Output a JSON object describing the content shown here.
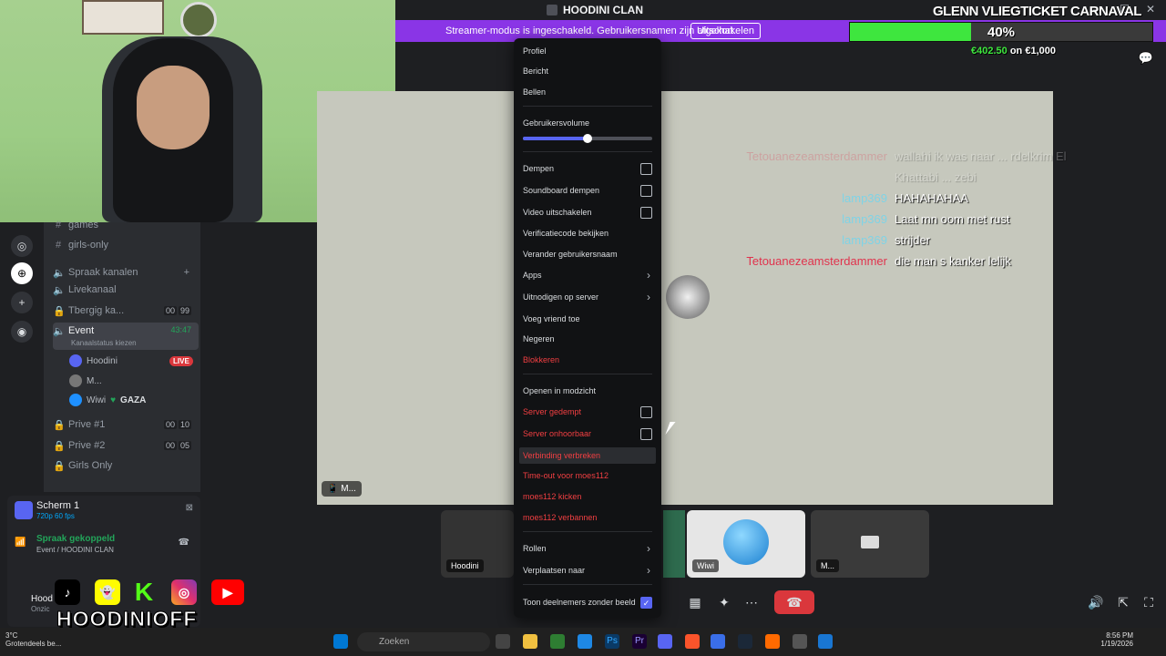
{
  "window": {
    "title": "HOODINI CLAN"
  },
  "banner": {
    "text": "Streamer-modus is ingeschakeld. Gebruikersnamen zijn afgekort.",
    "button": "Uitschakelen"
  },
  "overlay": {
    "title": "GLENN VLIEGTICKET CARNAVAL",
    "progress_percent": 40,
    "progress_label": "40%",
    "goal_current": "€402.50",
    "goal_sep": "on",
    "goal_target": "€1,000"
  },
  "channels": {
    "items": [
      {
        "label": "games",
        "icon": "#"
      },
      {
        "label": "girls-only",
        "icon": "#"
      }
    ],
    "voice_header": "Spraak kanalen",
    "voice": [
      {
        "label": "Livekanaal"
      },
      {
        "label": "Tbergig ka...",
        "c1": "00",
        "c2": "99"
      },
      {
        "label": "Event",
        "time": "43:47",
        "status": "Kanaalstatus kiezen"
      },
      {
        "label": "Prive #1",
        "c1": "00",
        "c2": "10"
      },
      {
        "label": "Prive #2",
        "c1": "00",
        "c2": "05"
      },
      {
        "label": "Girls Only"
      }
    ],
    "users": [
      {
        "name": "Hoodini",
        "badge": "LIVE"
      },
      {
        "name": "M..."
      },
      {
        "name": "Wiwi",
        "tag": "GAZA"
      }
    ]
  },
  "status": {
    "screen_title": "Scherm 1",
    "screen_sub": "720p 60 fps",
    "voice_title": "Spraak gekoppeld",
    "voice_sub": "Event / HOODINI CLAN",
    "user_name": "Hood",
    "user_sub": "Onzic"
  },
  "chat": [
    {
      "name": "Tetouanezeamsterdammer",
      "msg": "wallahi ik was naar ... rdelkrim El",
      "color": "#e0334d",
      "faded": true
    },
    {
      "name": "",
      "msg": "Khattabi ... zebi",
      "color": "#e0334d",
      "faded": true
    },
    {
      "name": "lamp369",
      "msg": "HAHAHAHAA",
      "color": "#7fd3e6"
    },
    {
      "name": "lamp369",
      "msg": "Laat mn oom met rust",
      "color": "#7fd3e6"
    },
    {
      "name": "lamp369",
      "msg": "strijder",
      "color": "#7fd3e6"
    },
    {
      "name": "Tetouanezeamsterdammer",
      "msg": "die man s kanker lelijk",
      "color": "#e0334d"
    }
  ],
  "stage": {
    "tag": "M..."
  },
  "thumbs": [
    {
      "tag": "Hoodini"
    },
    {
      "tag": "Wiwi"
    },
    {
      "tag": "M..."
    }
  ],
  "menu": {
    "profile": "Profiel",
    "message": "Bericht",
    "call": "Bellen",
    "volume_label": "Gebruikersvolume",
    "volume_value": 0.5,
    "mute": "Dempen",
    "soundboard_mute": "Soundboard dempen",
    "disable_video": "Video uitschakelen",
    "verification": "Verificatiecode bekijken",
    "change_username": "Verander gebruikersnaam",
    "apps": "Apps",
    "invite": "Uitnodigen op server",
    "add_friend": "Voeg vriend toe",
    "ignore": "Negeren",
    "block": "Blokkeren",
    "open_mod": "Openen in modzicht",
    "server_mute": "Server gedempt",
    "server_deafen": "Server onhoorbaar",
    "disconnect": "Verbinding verbreken",
    "timeout": "Time-out voor moes112",
    "kick": "moes112 kicken",
    "ban": "moes112 verbannen",
    "roles": "Rollen",
    "move_to": "Verplaatsen naar",
    "show_no_video": "Toon deelnemers zonder beeld"
  },
  "socials": {
    "name": "HOODINIOFF"
  },
  "taskbar": {
    "search": "Zoeken",
    "weather_temp": "3°C",
    "weather_desc": "Grotendeels be...",
    "time": "8:56 PM",
    "date": "1/19/2026"
  }
}
